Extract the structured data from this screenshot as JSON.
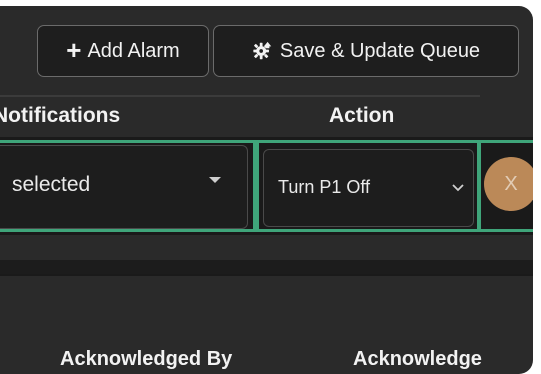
{
  "toolbar": {
    "add_alarm_label": "Add Alarm",
    "save_update_label": "Save & Update Queue"
  },
  "table": {
    "headers": {
      "notifications": "Notifications",
      "action": "Action"
    },
    "row": {
      "notifications_value": "selected",
      "action_value": "Turn P1 Off",
      "remove_label": "X"
    },
    "footer_headers": {
      "acknowledged_by": "Acknowledged By",
      "acknowledge": "Acknowledge"
    }
  },
  "icons": {
    "add": "plus-icon",
    "save": "gear-icon",
    "notif_caret": "caret-down-icon",
    "action_caret": "chevron-down-icon"
  },
  "colors": {
    "panel_bg": "#2a2a2a",
    "row_highlight": "#3fa57a",
    "remove_button": "#c9935e",
    "text": "#f2f2f2"
  }
}
